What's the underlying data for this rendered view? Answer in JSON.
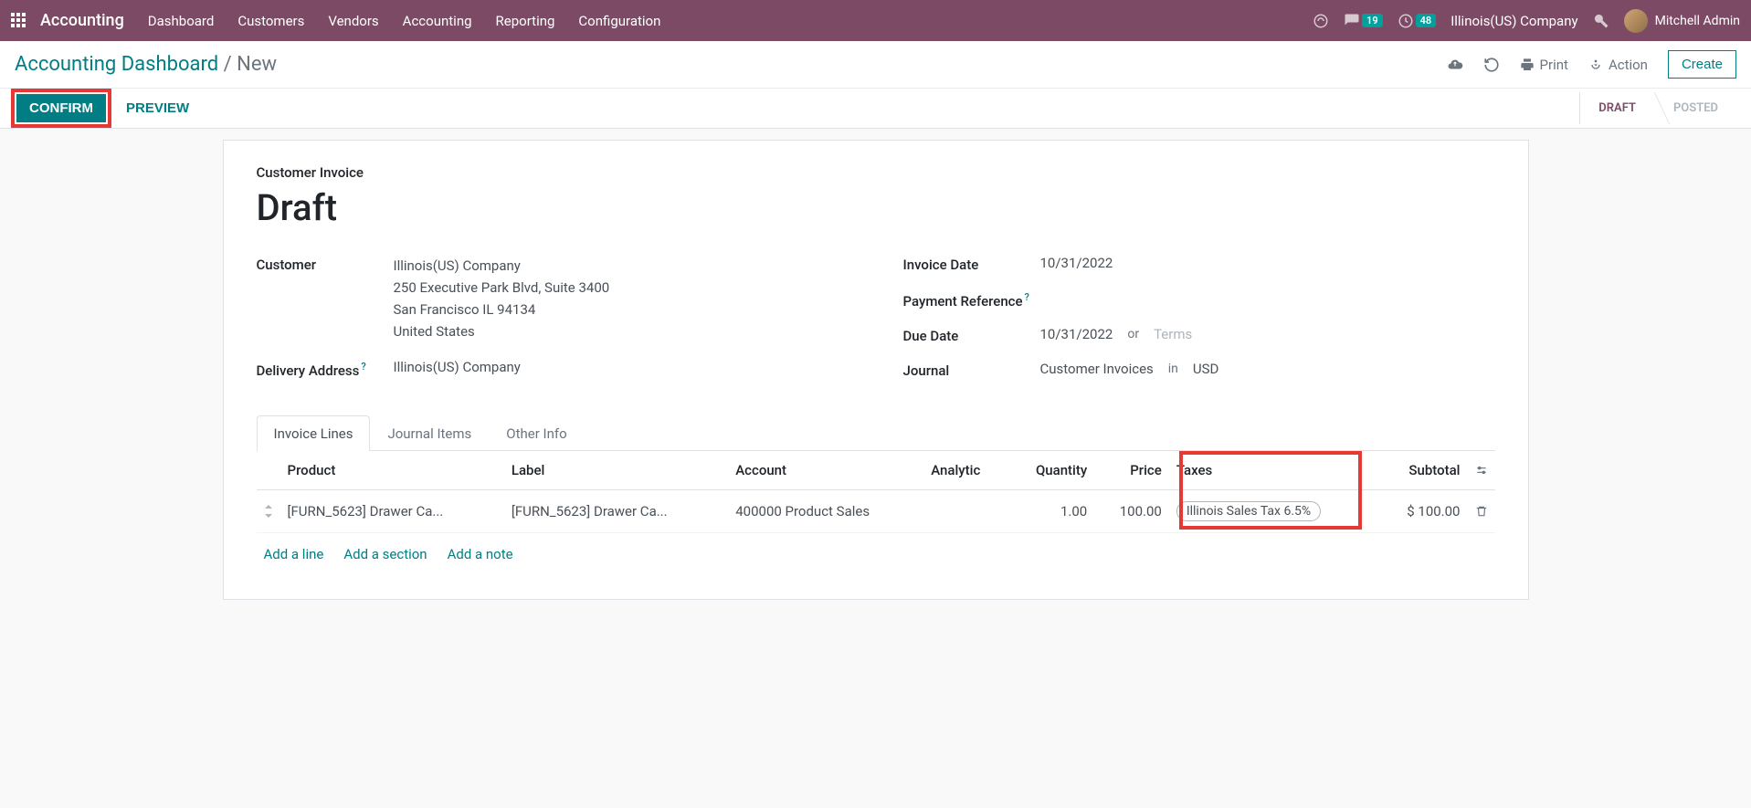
{
  "topnav": {
    "brand": "Accounting",
    "menu": [
      "Dashboard",
      "Customers",
      "Vendors",
      "Accounting",
      "Reporting",
      "Configuration"
    ],
    "messages_badge": "19",
    "activities_badge": "48",
    "company": "Illinois(US) Company",
    "user": "Mitchell Admin"
  },
  "breadcrumb": {
    "root": "Accounting Dashboard",
    "current": "New",
    "print": "Print",
    "action": "Action",
    "create": "Create"
  },
  "statusbar": {
    "confirm": "CONFIRM",
    "preview": "PREVIEW",
    "stages": [
      "DRAFT",
      "POSTED"
    ],
    "active_stage": "DRAFT"
  },
  "doc": {
    "type_label": "Customer Invoice",
    "title": "Draft",
    "customer_label": "Customer",
    "customer_name": "Illinois(US) Company",
    "customer_addr1": "250 Executive Park Blvd, Suite 3400",
    "customer_addr2": "San Francisco IL 94134",
    "customer_addr3": "United States",
    "delivery_label": "Delivery Address",
    "delivery_value": "Illinois(US) Company",
    "invoice_date_label": "Invoice Date",
    "invoice_date": "10/31/2022",
    "payment_ref_label": "Payment Reference",
    "due_date_label": "Due Date",
    "due_date": "10/31/2022",
    "due_or": "or",
    "due_terms_placeholder": "Terms",
    "journal_label": "Journal",
    "journal_value": "Customer Invoices",
    "journal_in": "in",
    "journal_currency": "USD"
  },
  "tabs": {
    "items": [
      "Invoice Lines",
      "Journal Items",
      "Other Info"
    ]
  },
  "table": {
    "headers": {
      "product": "Product",
      "label": "Label",
      "account": "Account",
      "analytic": "Analytic",
      "quantity": "Quantity",
      "price": "Price",
      "taxes": "Taxes",
      "subtotal": "Subtotal"
    },
    "rows": [
      {
        "product": "[FURN_5623] Drawer Ca...",
        "label": "[FURN_5623] Drawer Ca...",
        "account": "400000 Product Sales",
        "analytic": "",
        "quantity": "1.00",
        "price": "100.00",
        "taxes": "Illinois Sales Tax 6.5%",
        "subtotal": "$ 100.00"
      }
    ],
    "add_line": "Add a line",
    "add_section": "Add a section",
    "add_note": "Add a note"
  }
}
